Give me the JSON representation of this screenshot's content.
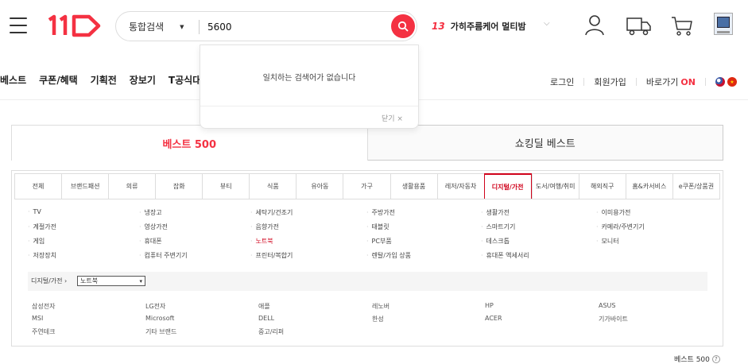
{
  "header": {
    "search": {
      "type_label": "통합검색",
      "value": "5600"
    },
    "trending": {
      "rank": "13",
      "keyword": "가히주름케어 멀티밤"
    },
    "icons": [
      "menu-icon",
      "search-icon",
      "user-icon",
      "truck-icon",
      "cart-icon",
      "recent-product-thumbnail"
    ]
  },
  "autocomplete": {
    "message": "일치하는 검색어가 없습니다",
    "close_label": "닫기 ×"
  },
  "gnb": {
    "items": [
      "베스트",
      "쿠폰/혜택",
      "기획전",
      "장보기",
      "T공식대"
    ]
  },
  "util": {
    "login": "로그인",
    "join": "회원가입",
    "shortcut": "바로가기",
    "shortcut_state": "ON"
  },
  "best_tabs": {
    "best500": "베스트 500",
    "shocking": "쇼킹딜 베스트"
  },
  "categories": {
    "tabs": [
      "전체",
      "브랜드패션",
      "의류",
      "잡화",
      "뷰티",
      "식품",
      "유아동",
      "가구",
      "생활용품",
      "레저/자동차",
      "디지털/가전",
      "도서/여행/취미",
      "해외직구",
      "홈&카서비스",
      "e쿠폰/상품권"
    ],
    "active_index": 10,
    "sub": [
      [
        "TV",
        "냉장고",
        "세탁기/건조기",
        "주방가전",
        "생활가전",
        "이미용가전"
      ],
      [
        "계절가전",
        "영상가전",
        "음향가전",
        "태블릿",
        "스마트기기",
        "카메라/주변기기"
      ],
      [
        "게임",
        "휴대폰",
        "노트북",
        "PC부품",
        "데스크톱",
        "모니터"
      ],
      [
        "저장장치",
        "컴퓨터 주변기기",
        "프린터/복합기",
        "렌탈/가입 상품",
        "휴대폰 액세서리"
      ]
    ],
    "selected_sub": "노트북",
    "breadcrumb": "디지털/가전",
    "select_value": "노트북",
    "brands": [
      [
        "삼성전자",
        "LG전자",
        "애플",
        "레노버",
        "HP",
        "ASUS"
      ],
      [
        "MSI",
        "Microsoft",
        "DELL",
        "한성",
        "ACER",
        "기가바이트"
      ],
      [
        "주연테크",
        "기타 브랜드",
        "중고/리퍼"
      ]
    ]
  },
  "footer": {
    "label": "베스트 500"
  },
  "colors": {
    "accent": "#f43142",
    "active_category": "#d0021b"
  }
}
